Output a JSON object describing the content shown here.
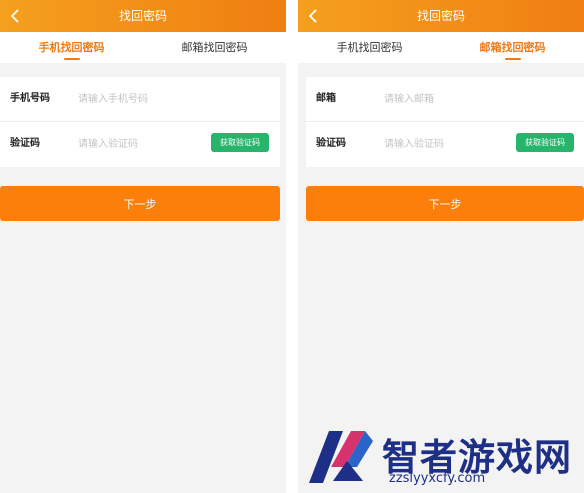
{
  "left_screen": {
    "header": {
      "back_icon": "chevron-left-icon",
      "title": "找回密码"
    },
    "tabs": [
      {
        "label": "手机找回密码",
        "active": true
      },
      {
        "label": "邮箱找回密码",
        "active": false
      }
    ],
    "form": {
      "fields": [
        {
          "label": "手机号码",
          "placeholder": "请输入手机号码"
        },
        {
          "label": "验证码",
          "placeholder": "请输入验证码",
          "action": "获取验证码"
        }
      ]
    },
    "next_label": "下一步"
  },
  "right_screen": {
    "header": {
      "back_icon": "chevron-left-icon",
      "title": "找回密码"
    },
    "tabs": [
      {
        "label": "手机找回密码",
        "active": false
      },
      {
        "label": "邮箱找回密码",
        "active": true
      }
    ],
    "form": {
      "fields": [
        {
          "label": "邮箱",
          "placeholder": "请输入邮箱"
        },
        {
          "label": "验证码",
          "placeholder": "请输入验证码",
          "action": "获取验证码"
        }
      ]
    },
    "next_label": "下一步"
  },
  "colors": {
    "header_gradient_start": "#f5a01e",
    "header_gradient_end": "#f07e12",
    "accent_orange": "#ef7a16",
    "button_orange": "#fb7f0a",
    "code_button_green": "#27b46b",
    "watermark_blue": "#1d2f86"
  },
  "watermark": {
    "name": "智者游戏网",
    "url": "zzslyyxcfy.com"
  }
}
